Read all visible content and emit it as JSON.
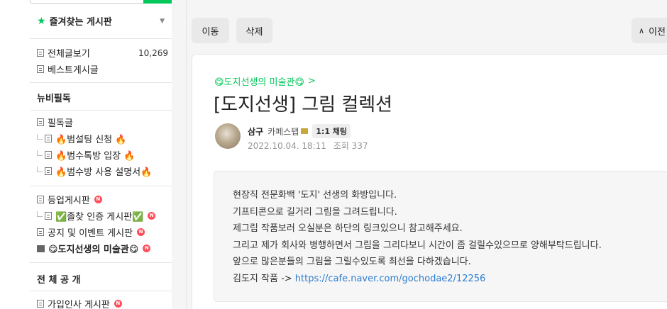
{
  "sidebar": {
    "favorites_title": "즐겨찾는 게시판",
    "favorites": [
      {
        "label": "전체글보기",
        "count": "10,269"
      },
      {
        "label": "베스트게시글"
      }
    ],
    "section_newbie": "뉴비필독",
    "newbie_items": [
      {
        "label": "필독글"
      },
      {
        "label": "🔥범설팅 신청 🔥"
      },
      {
        "label": "🔥범수톡방 입장 🔥"
      },
      {
        "label": "🔥범수방 사용 설명서🔥"
      }
    ],
    "boards": [
      {
        "label": "등업게시판",
        "badge": "N"
      },
      {
        "label": "✅졸찾 인증 게시판✅",
        "badge": "N"
      },
      {
        "label": "공지 및 이벤트 게시판",
        "badge": "N"
      },
      {
        "label": "😋도지선생의 미술관😋",
        "badge": "N"
      }
    ],
    "section_public": "전 체 공 개",
    "public_items": [
      {
        "label": "가입인사 게시판",
        "badge": "N"
      }
    ]
  },
  "toolbar": {
    "move_label": "이동",
    "delete_label": "삭제",
    "prev_label": "이전"
  },
  "article": {
    "board_link": "😋도지선생의 미술관😋",
    "title": "[도지선생] 그림 컬렉션",
    "author": "삼구",
    "grade": "카페스탭",
    "chat_label": "1:1 채팅",
    "date": "2022.10.04. 18:11",
    "views": "조회 337",
    "body": [
      "현장직 전문화백 '도지' 선생의 화방입니다.",
      "기프티콘으로 길거리 그림을 그려드립니다.",
      "제그림 작품보러 오실분은 하단의 링크있으니 참고해주세요.",
      "그리고 제가 회사와 병행하면서 그림을 그리다보니 시간이 좀 걸릴수있으므로 양해부탁드립니다.",
      "앞으로 많은분들의 그림을 그릴수있도록 최선을 다하겠습니다."
    ],
    "link_prefix": "김도지 작품 -> ",
    "link_url": "https://cafe.naver.com/gochodae2/12256"
  },
  "colors": {
    "accent": "#03c75a",
    "badge": "#ff4e59",
    "link": "#2d7dd2"
  }
}
